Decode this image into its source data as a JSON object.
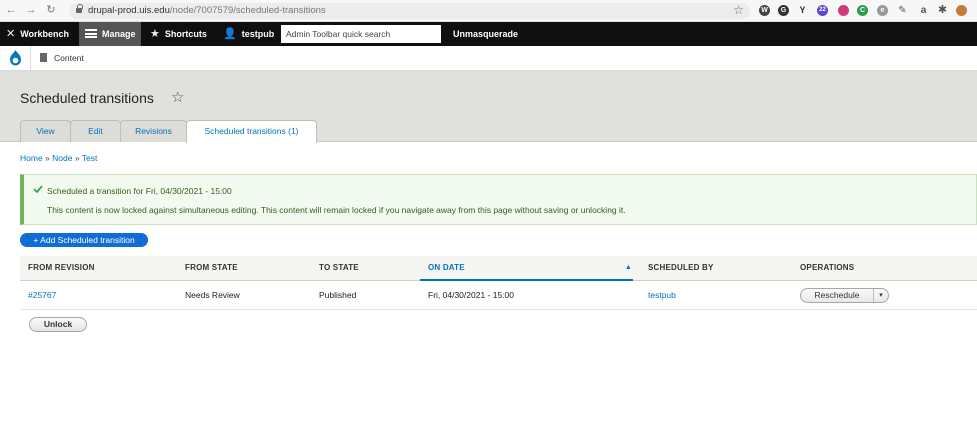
{
  "browser": {
    "url_host": "drupal-prod.uis.edu",
    "url_path": "/node/7007579/scheduled-transitions",
    "extensions": [
      "W",
      "G",
      "Y",
      "22",
      "C",
      "e",
      "a"
    ]
  },
  "toolbar": {
    "workbench": "Workbench",
    "manage": "Manage",
    "shortcuts": "Shortcuts",
    "user": "testpub",
    "search_placeholder": "Admin Toolbar quick search",
    "unmasquerade": "Unmasquerade"
  },
  "tray": {
    "content": "Content"
  },
  "page": {
    "title": "Scheduled transitions",
    "tabs": [
      {
        "label": "View"
      },
      {
        "label": "Edit"
      },
      {
        "label": "Revisions"
      },
      {
        "label": "Scheduled transitions (1)"
      }
    ]
  },
  "breadcrumb": {
    "home": "Home",
    "sep": " » ",
    "node": "Node",
    "test": "Test"
  },
  "message": {
    "line1": "Scheduled a transition for Fri, 04/30/2021 - 15:00",
    "line2": "This content is now locked against simultaneous editing. This content will remain locked if you navigate away from this page without saving or unlocking it."
  },
  "actions": {
    "add": "+ Add Scheduled transition",
    "unlock": "Unlock"
  },
  "table": {
    "headers": [
      "FROM REVISION",
      "FROM STATE",
      "TO STATE",
      "ON DATE",
      "SCHEDULED BY",
      "OPERATIONS"
    ],
    "sort_arrow": "▲",
    "rows": [
      {
        "revision": "#25767",
        "from_state": "Needs Review",
        "to_state": "Published",
        "on_date": "Fri, 04/30/2021 - 15:00",
        "scheduled_by": "testpub",
        "operation": "Reschedule",
        "operation_toggle": "▾"
      }
    ]
  },
  "colors": {
    "toolbar_bg": "#0f0f0f",
    "link": "#0074bd",
    "primary_button": "#0f6ed4",
    "success_border": "#77b259",
    "header_band": "#e0e0dd"
  }
}
